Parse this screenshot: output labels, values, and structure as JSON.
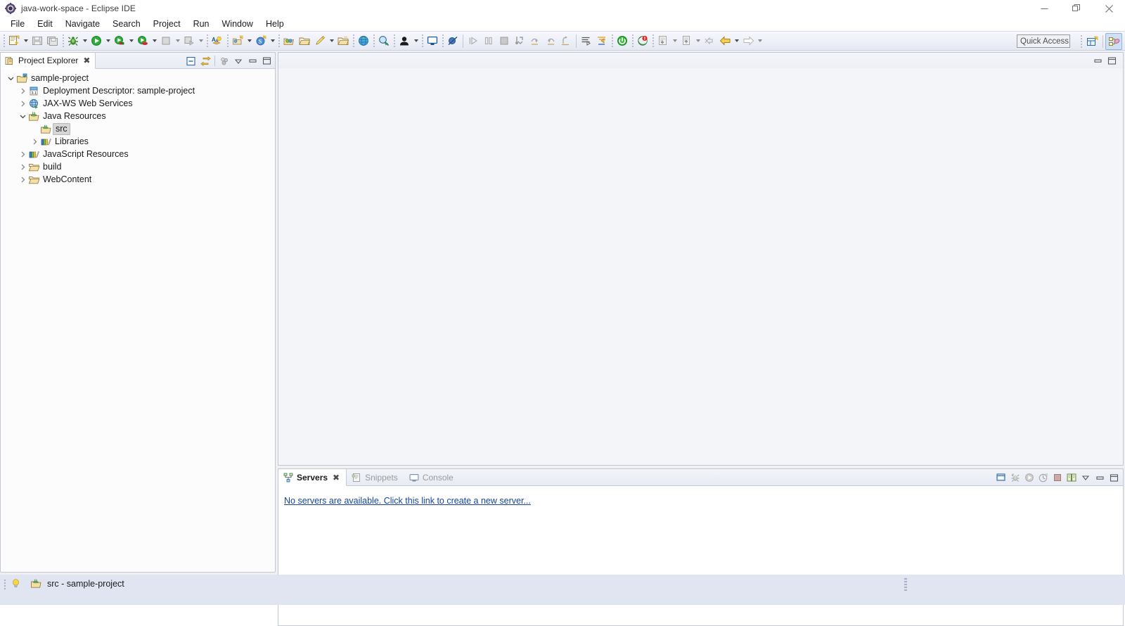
{
  "window": {
    "title": "java-work-space - Eclipse IDE",
    "app_icon": "eclipse-icon",
    "controls": [
      {
        "name": "minimize-button",
        "glyph": "—"
      },
      {
        "name": "maximize-button",
        "glyph": "❐"
      },
      {
        "name": "close-button",
        "glyph": "✕"
      }
    ]
  },
  "menubar": {
    "items": [
      {
        "label": "File"
      },
      {
        "label": "Edit"
      },
      {
        "label": "Navigate"
      },
      {
        "label": "Search"
      },
      {
        "label": "Project"
      },
      {
        "label": "Run"
      },
      {
        "label": "Window"
      },
      {
        "label": "Help"
      }
    ]
  },
  "toolbar": {
    "quick_access_placeholder": "Quick Access",
    "buttons": [
      {
        "name": "new-wizard-button",
        "icon": "new-file-icon",
        "enabled": true,
        "dropdown": true
      },
      {
        "name": "save-button",
        "icon": "save-icon",
        "enabled": false
      },
      {
        "name": "save-all-button",
        "icon": "save-all-icon",
        "enabled": false
      },
      {
        "name": "debug-button",
        "icon": "debug-bug-icon",
        "enabled": true,
        "dropdown": true
      },
      {
        "name": "run-button",
        "icon": "run-green-play-icon",
        "enabled": true,
        "dropdown": true
      },
      {
        "name": "run-external-tools-button",
        "icon": "run-server-icon",
        "enabled": true,
        "dropdown": true
      },
      {
        "name": "profile-button",
        "icon": "profile-icon",
        "enabled": true,
        "dropdown": true
      },
      {
        "name": "stop-button",
        "icon": "stop-square-icon",
        "enabled": false,
        "dropdown": true
      },
      {
        "name": "coverage-button",
        "icon": "coverage-icon",
        "enabled": false,
        "dropdown": true
      },
      {
        "name": "new-java-project-button",
        "icon": "new-java-project-icon",
        "enabled": true
      },
      {
        "name": "new-package-button",
        "icon": "new-package-icon",
        "enabled": true,
        "dropdown": true
      },
      {
        "name": "new-class-button",
        "icon": "new-class-icon",
        "enabled": true,
        "dropdown": true
      },
      {
        "name": "open-type-button",
        "icon": "open-type-icon",
        "enabled": true
      },
      {
        "name": "open-task-button",
        "icon": "open-folder-icon",
        "enabled": true
      },
      {
        "name": "new-annotation-button",
        "icon": "pen-icon",
        "enabled": true,
        "dropdown": true
      },
      {
        "name": "open-resource-button",
        "icon": "open-resource-icon",
        "enabled": true
      },
      {
        "name": "open-web-browser-button",
        "icon": "globe-icon",
        "enabled": true
      },
      {
        "name": "search-button",
        "icon": "search-magnifier-icon",
        "enabled": true
      },
      {
        "name": "user-button",
        "icon": "user-avatar-icon",
        "enabled": true,
        "dropdown": true
      },
      {
        "name": "console-button",
        "icon": "monitor-icon",
        "enabled": true
      },
      {
        "name": "skip-breakpoints-button",
        "icon": "skip-breakpoints-icon",
        "enabled": true
      },
      {
        "name": "resume-button",
        "icon": "resume-play-icon",
        "enabled": false
      },
      {
        "name": "suspend-button",
        "icon": "suspend-pause-icon",
        "enabled": false
      },
      {
        "name": "terminate-button",
        "icon": "terminate-stop-icon",
        "enabled": false
      },
      {
        "name": "step-into-button",
        "icon": "step-into-icon",
        "enabled": false
      },
      {
        "name": "step-over-button",
        "icon": "step-over-icon",
        "enabled": false
      },
      {
        "name": "step-return-button",
        "icon": "step-return-icon",
        "enabled": false
      },
      {
        "name": "drop-to-frame-button",
        "icon": "drop-to-frame-icon",
        "enabled": false
      },
      {
        "name": "next-annotation-button",
        "icon": "next-annotation-icon",
        "enabled": true
      },
      {
        "name": "previous-annotation-button",
        "icon": "previous-annotation-icon",
        "enabled": true
      },
      {
        "name": "start-server-button",
        "icon": "power-green-icon",
        "enabled": true
      },
      {
        "name": "validate-button",
        "icon": "validate-icon",
        "enabled": true
      },
      {
        "name": "download-button",
        "icon": "download-icon",
        "enabled": false,
        "dropdown": true
      },
      {
        "name": "upload-button",
        "icon": "upload-icon",
        "enabled": false,
        "dropdown": true
      },
      {
        "name": "back-nav-button",
        "icon": "back-small-arrow-icon",
        "enabled": false
      },
      {
        "name": "back-button",
        "icon": "back-arrow-icon",
        "enabled": true,
        "dropdown": true
      },
      {
        "name": "forward-button",
        "icon": "forward-arrow-icon",
        "enabled": false,
        "dropdown": true
      }
    ],
    "perspective": [
      {
        "name": "open-perspective-button",
        "icon": "open-perspective-icon",
        "active": false
      },
      {
        "name": "perspective-java-ee-button",
        "icon": "java-ee-perspective-icon",
        "active": true
      }
    ]
  },
  "project_explorer": {
    "tab_label": "Project Explorer",
    "tab_icon": "project-explorer-icon",
    "close_glyph": "✖",
    "toolbar": [
      {
        "name": "collapse-all-button",
        "icon": "collapse-all-icon"
      },
      {
        "name": "link-with-editor-button",
        "icon": "link-editor-icon"
      },
      {
        "name": "view-menu-focus-button",
        "icon": "focus-icon"
      },
      {
        "name": "view-menu-button",
        "icon": "view-menu-chevron-icon"
      },
      {
        "name": "minimize-view-button",
        "icon": "minimize-icon"
      },
      {
        "name": "maximize-view-button",
        "icon": "maximize-icon"
      }
    ],
    "tree": [
      {
        "label": "sample-project",
        "icon": "project-icon",
        "depth": 0,
        "state": "expanded",
        "selected": false
      },
      {
        "label": "Deployment Descriptor: sample-project",
        "icon": "deployment-descriptor-icon",
        "depth": 1,
        "state": "collapsed",
        "selected": false
      },
      {
        "label": "JAX-WS Web Services",
        "icon": "jaxws-icon",
        "depth": 1,
        "state": "collapsed",
        "selected": false
      },
      {
        "label": "Java Resources",
        "icon": "java-resources-icon",
        "depth": 1,
        "state": "expanded",
        "selected": false
      },
      {
        "label": "src",
        "icon": "source-folder-icon",
        "depth": 2,
        "state": "leaf",
        "selected": true
      },
      {
        "label": "Libraries",
        "icon": "libraries-icon",
        "depth": 2,
        "state": "collapsed",
        "selected": false
      },
      {
        "label": "JavaScript Resources",
        "icon": "libraries-icon",
        "depth": 1,
        "state": "collapsed",
        "selected": false
      },
      {
        "label": "build",
        "icon": "folder-icon",
        "depth": 1,
        "state": "collapsed",
        "selected": false
      },
      {
        "label": "WebContent",
        "icon": "folder-icon",
        "depth": 1,
        "state": "collapsed",
        "selected": false
      }
    ]
  },
  "editor_area": {
    "buttons": [
      {
        "name": "minimize-editor-button",
        "icon": "minimize-icon"
      },
      {
        "name": "maximize-editor-button",
        "icon": "maximize-icon"
      }
    ]
  },
  "bottom_panel": {
    "tabs": [
      {
        "label": "Servers",
        "icon": "servers-icon",
        "active": true,
        "close_glyph": "✖"
      },
      {
        "label": "Snippets",
        "icon": "snippets-icon",
        "active": false
      },
      {
        "label": "Console",
        "icon": "console-icon",
        "active": false
      }
    ],
    "toolbar": [
      {
        "name": "new-server-button",
        "icon": "new-server-icon"
      },
      {
        "name": "debug-server-button",
        "icon": "debug-server-icon"
      },
      {
        "name": "start-server-button",
        "icon": "start-server-icon"
      },
      {
        "name": "profile-server-button",
        "icon": "profile-server-icon"
      },
      {
        "name": "stop-server-button",
        "icon": "stop-server-icon"
      },
      {
        "name": "publish-server-button",
        "icon": "publish-server-icon"
      },
      {
        "name": "view-menu-button",
        "icon": "view-menu-chevron-icon"
      },
      {
        "name": "minimize-view-button",
        "icon": "minimize-icon"
      },
      {
        "name": "maximize-view-button",
        "icon": "maximize-icon"
      }
    ],
    "empty_message": "No servers are available. Click this link to create a new server..."
  },
  "statusbar": {
    "selection_icon": "source-folder-icon",
    "hint_icon": "lightbulb-icon",
    "selection_text": "src - sample-project"
  },
  "colors": {
    "accent_blue": "#16449c",
    "toolbar_bg": "#eef0f7",
    "statusbar_bg": "#e1e5f2",
    "selection_gray": "#d6d6d6",
    "link_blue": "#16449c"
  }
}
